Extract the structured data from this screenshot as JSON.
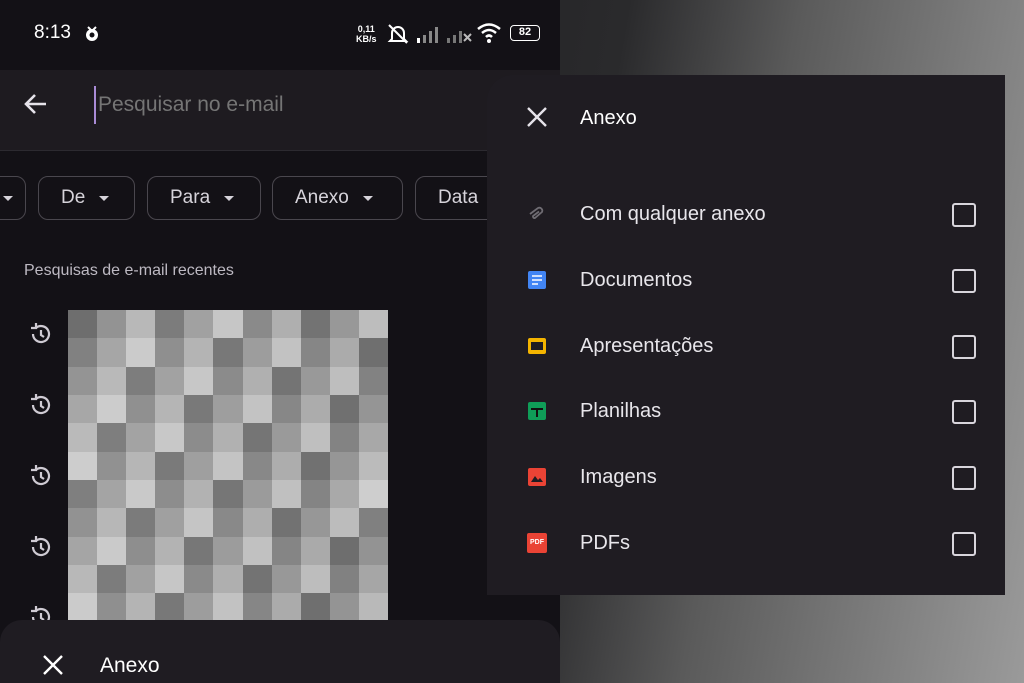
{
  "status_bar": {
    "time": "8:13",
    "speed_value": "0,11",
    "speed_unit": "KB/s",
    "battery": "82"
  },
  "search": {
    "placeholder": "Pesquisar no e-mail"
  },
  "chips": [
    {
      "label": "De"
    },
    {
      "label": "Para"
    },
    {
      "label": "Anexo"
    },
    {
      "label": "Data"
    }
  ],
  "recent": {
    "title": "Pesquisas de e-mail recentes"
  },
  "bottom_sheet": {
    "title": "Anexo"
  },
  "panel": {
    "title": "Anexo",
    "options": [
      {
        "label": "Com qualquer anexo",
        "icon": "paperclip-icon",
        "color": "#6f6c73"
      },
      {
        "label": "Documentos",
        "icon": "docs-icon",
        "color": "#4285f4"
      },
      {
        "label": "Apresentações",
        "icon": "slides-icon",
        "color": "#f4b400"
      },
      {
        "label": "Planilhas",
        "icon": "sheets-icon",
        "color": "#0f9d58"
      },
      {
        "label": "Imagens",
        "icon": "image-icon",
        "color": "#ea4335"
      },
      {
        "label": "PDFs",
        "icon": "pdf-icon",
        "color": "#ea4335"
      }
    ]
  }
}
